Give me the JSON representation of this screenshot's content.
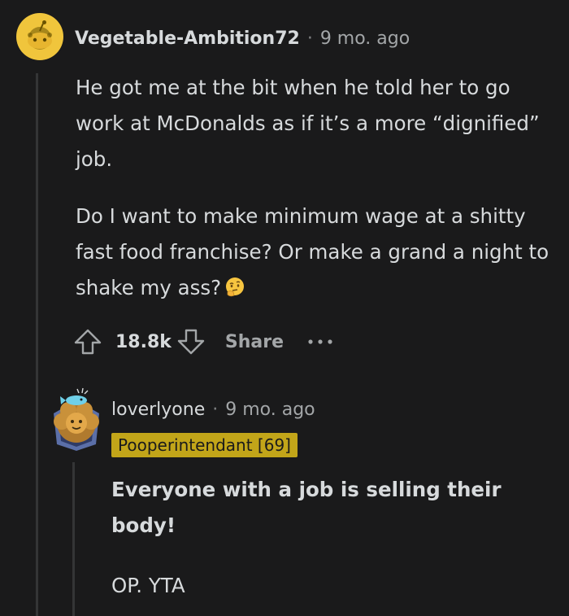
{
  "comment1": {
    "author": "Vegetable-Ambition72",
    "separator": "·",
    "time": "9 mo. ago",
    "paragraphs": [
      "He got me at the bit when he told her to go work at McDonalds as if it’s a more “dignified” job.",
      "Do I want to make minimum wage at a shitty fast food franchise? Or make a grand a night to shake my ass?"
    ],
    "emoji_icon": "thinking-face-icon",
    "score": "18.8k",
    "share_label": "Share",
    "more_icon": "more-options-icon"
  },
  "comment2": {
    "author": "loverlyone",
    "separator": "·",
    "time": "9 mo. ago",
    "flair": "Pooperintendant [69]",
    "paragraphs": [
      "Everyone with a job is selling their body!",
      "OP. YTA"
    ]
  },
  "colors": {
    "background": "#1a1a1b",
    "text": "#d7dadc",
    "muted": "#a3a6a8",
    "thread_line": "#343536",
    "flair_bg": "#c2a519",
    "avatar_yellow": "#f0c53c"
  }
}
